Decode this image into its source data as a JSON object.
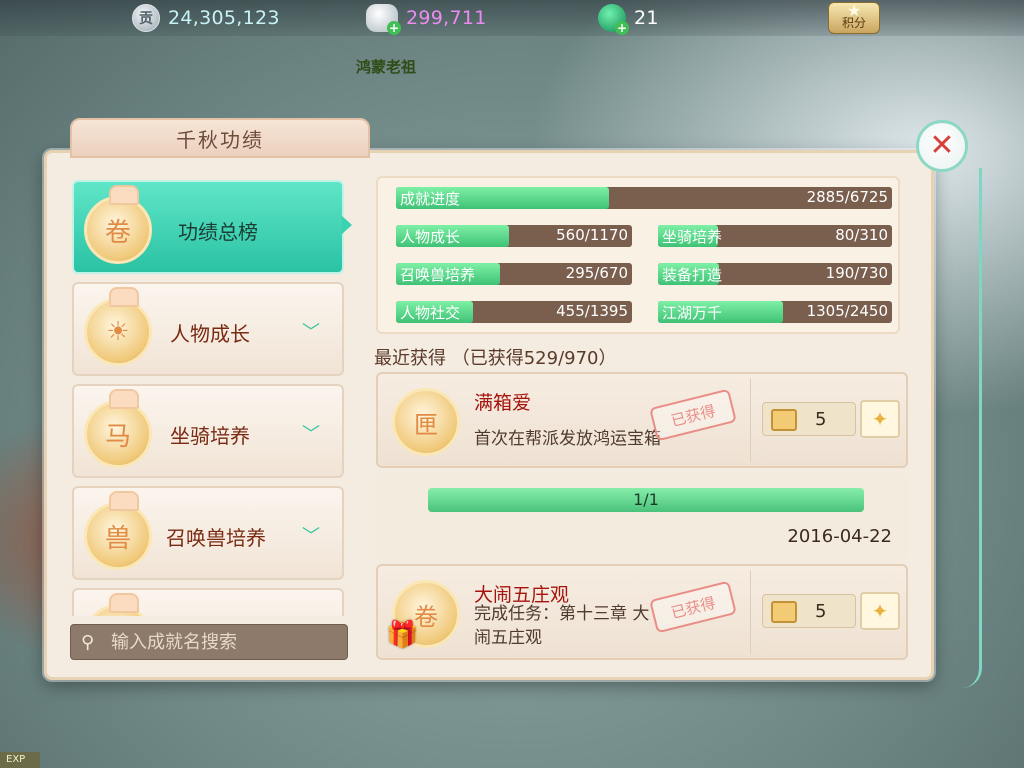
{
  "topbar": {
    "gong": {
      "icon": "gong-coin-icon",
      "symbol": "贡",
      "value": "24,305,123"
    },
    "silver": {
      "icon": "silver-ingot-icon",
      "value": "299,711"
    },
    "jade": {
      "icon": "jade-icon",
      "value": "21"
    },
    "score_label": "积分"
  },
  "npc_name": "鸿蒙老祖",
  "exp_label": "EXP",
  "panel": {
    "title": "千秋功绩",
    "close_symbol": "✕"
  },
  "sidebar": {
    "items": [
      {
        "label": "功绩总榜",
        "medal": "卷",
        "active": true
      },
      {
        "label": "人物成长",
        "medal": "☀",
        "active": false
      },
      {
        "label": "坐骑培养",
        "medal": "马",
        "active": false
      },
      {
        "label": "召唤兽培养",
        "medal": "兽",
        "active": false
      },
      {
        "label": "",
        "medal": "",
        "active": false
      }
    ]
  },
  "search": {
    "placeholder": "输入成就名搜索"
  },
  "progress": {
    "overall": {
      "name": "成就进度",
      "value": "2885/6725",
      "current": 2885,
      "total": 6725
    },
    "categories": [
      {
        "name": "人物成长",
        "value": "560/1170",
        "current": 560,
        "total": 1170
      },
      {
        "name": "坐骑培养",
        "value": "80/310",
        "current": 80,
        "total": 310
      },
      {
        "name": "召唤兽培养",
        "value": "295/670",
        "current": 295,
        "total": 670
      },
      {
        "name": "装备打造",
        "value": "190/730",
        "current": 190,
        "total": 730
      },
      {
        "name": "人物社交",
        "value": "455/1395",
        "current": 455,
        "total": 1395
      },
      {
        "name": "江湖万千",
        "value": "1305/2450",
        "current": 1305,
        "total": 2450
      }
    ]
  },
  "recent": {
    "label": "最近获得 （已获得529/970）",
    "achievements": [
      {
        "title": "满箱爱",
        "desc": "首次在帮派发放鸿运宝箱",
        "stamp": "已获得",
        "reward_count": "5",
        "detail_progress": "1/1",
        "detail_fraction": 1.0,
        "date": "2016-04-22"
      },
      {
        "title": "大闹五庄观",
        "desc": "完成任务：第十三章 大闹五庄观",
        "stamp": "已获得",
        "reward_count": "5"
      }
    ]
  }
}
